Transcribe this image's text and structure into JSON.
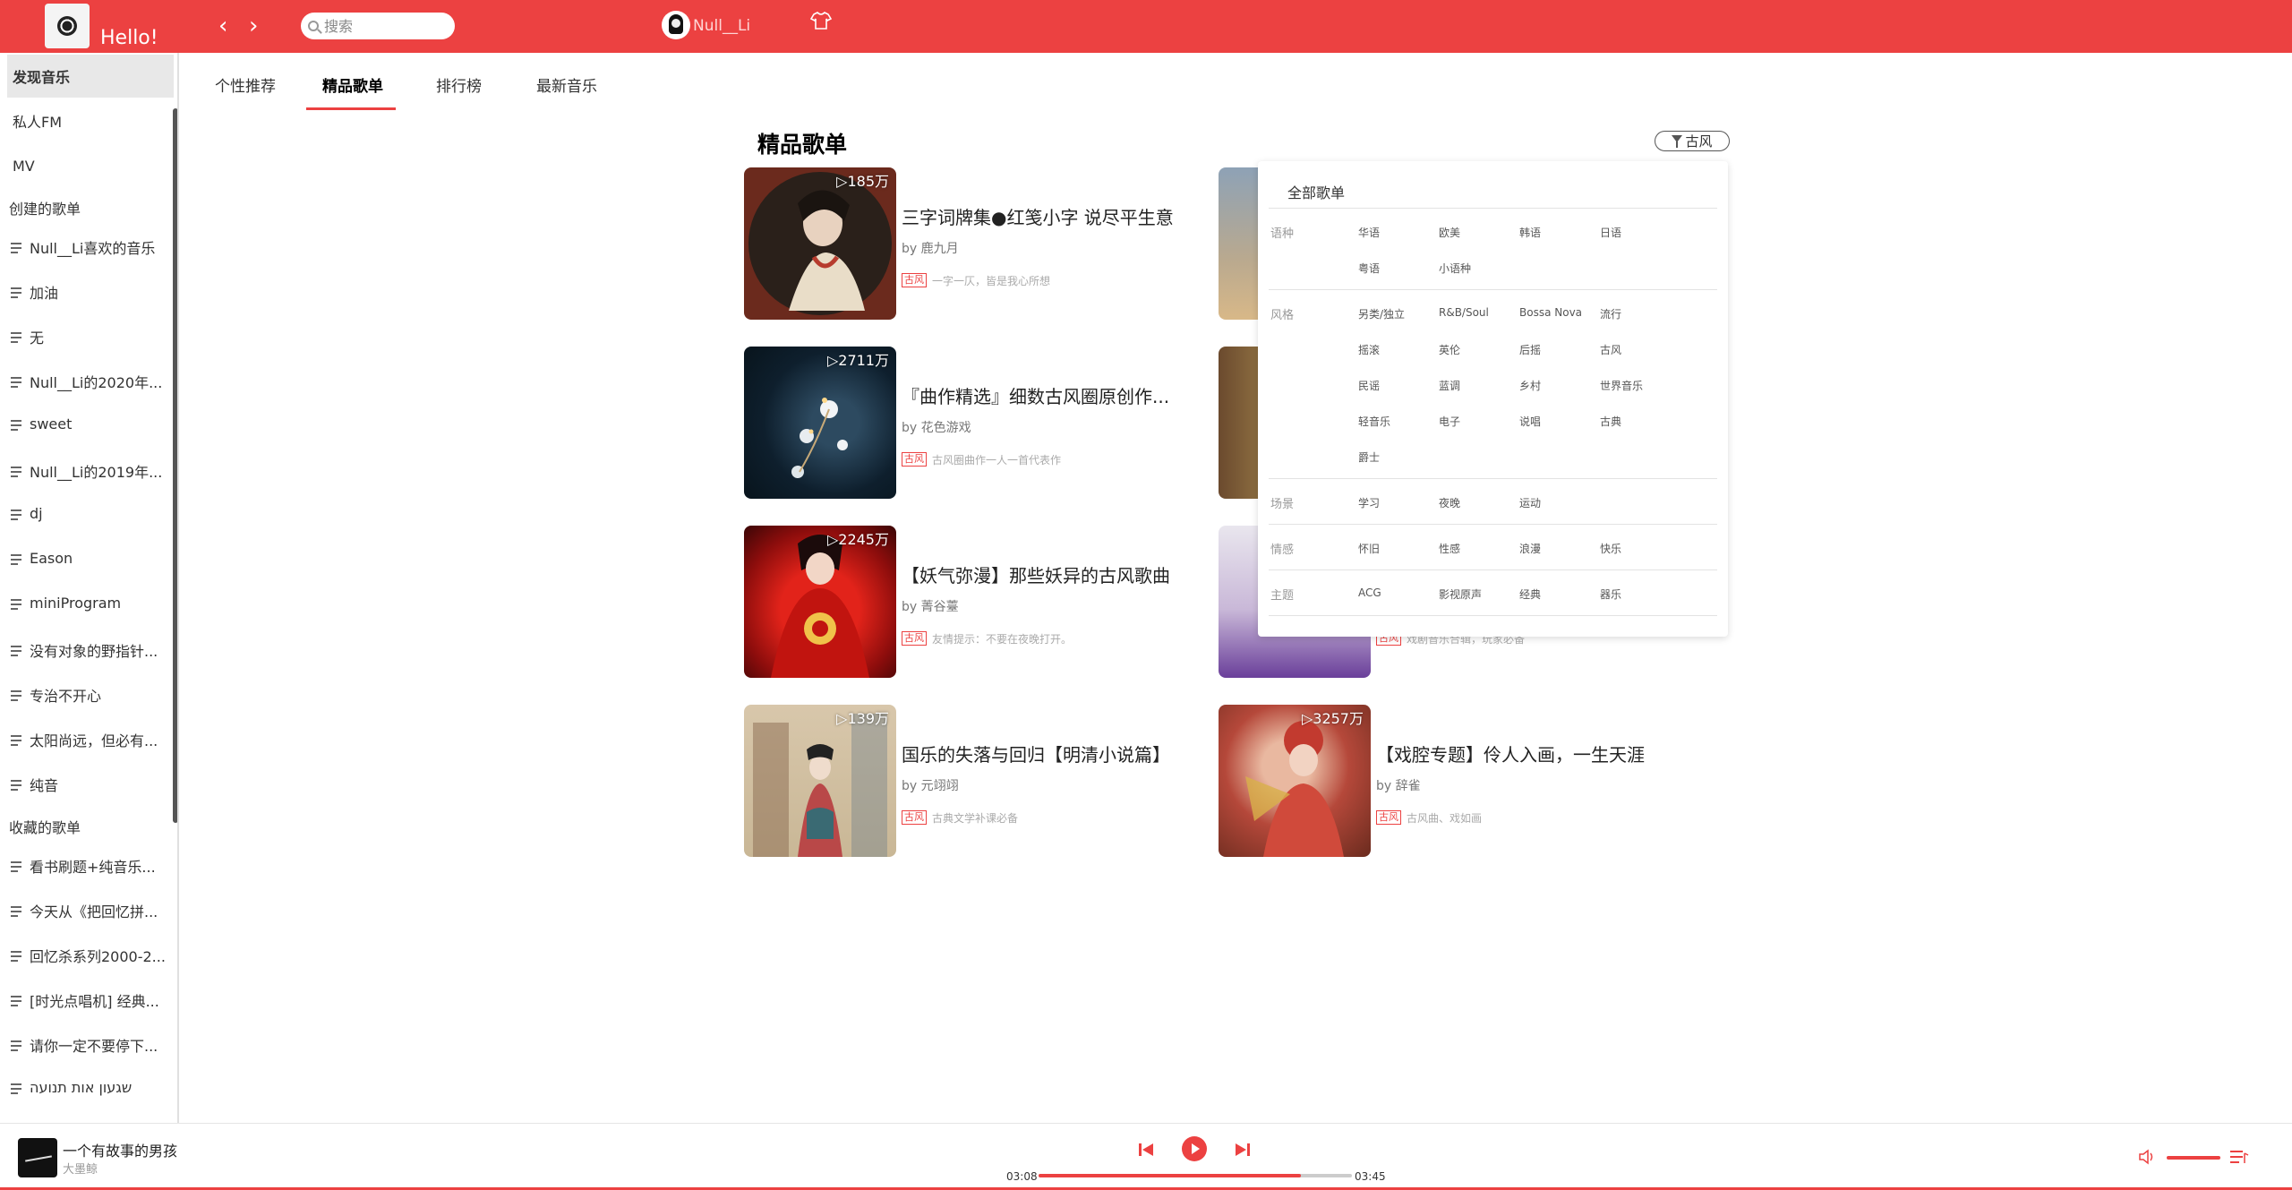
{
  "header": {
    "greeting": "Hello!",
    "search_placeholder": "搜索",
    "user_name": "Null__Li"
  },
  "sidebar": {
    "nav": [
      {
        "label": "发现音乐",
        "active": true
      },
      {
        "label": "私人FM"
      },
      {
        "label": "MV"
      }
    ],
    "created_title": "创建的歌单",
    "created": [
      "Null__Li喜欢的音乐",
      "加油",
      "无",
      "Null__Li的2020年...",
      "sweet",
      "Null__Li的2019年...",
      "dj",
      "Eason",
      "miniProgram",
      "没有对象的野指针...",
      "专治不开心",
      "太阳尚远，但必有...",
      "纯音"
    ],
    "collected_title": "收藏的歌单",
    "collected": [
      "看书刷题+纯音乐...",
      "今天从《把回忆拼...",
      "回忆杀系列2000-2...",
      "[时光点唱机] 经典...",
      "请你一定不要停下...",
      "שגעון אות תנועה"
    ]
  },
  "tabs": [
    "个性推荐",
    "精品歌单",
    "排行榜",
    "最新音乐"
  ],
  "main": {
    "title": "精品歌单",
    "filter_label": "古风",
    "playlists": [
      {
        "count": "185万",
        "name": "三字词牌集●红笺小字 说尽平生意",
        "by": "by 鹿九月",
        "tag": "古风",
        "desc": "一字一仄，皆是我心所想"
      },
      {
        "count": "2711万",
        "name": "『曲作精选』细数古风圈原创作...",
        "by": "by 花色游戏",
        "tag": "古风",
        "desc": "古风圈曲作一人一首代表作"
      },
      {
        "count": "2245万",
        "name": "【妖气弥漫】那些妖异的古风歌曲",
        "by": "by 菁谷薹",
        "tag": "古风",
        "desc": "友情提示：不要在夜晚打开。"
      },
      {
        "count": "139万",
        "name": "国乐的失落与回归【明清小说篇】",
        "by": "by 元翊翊",
        "tag": "古风",
        "desc": "古典文学补课必备"
      },
      {
        "count": "",
        "name": "",
        "by": "",
        "tag": "古风",
        "desc": "戏剧音乐合辑，玩家必备"
      },
      {
        "count": "3257万",
        "name": "【戏腔专题】伶人入画，一生天涯",
        "by": "by 辞雀",
        "tag": "古风",
        "desc": "古风曲、戏如画"
      }
    ]
  },
  "dropdown": {
    "all_label": "全部歌单",
    "groups": [
      {
        "name": "语种",
        "rows": [
          [
            "华语",
            "欧美",
            "韩语",
            "日语"
          ],
          [
            "粤语",
            "小语种"
          ]
        ]
      },
      {
        "name": "风格",
        "rows": [
          [
            "另类/独立",
            "R&B/Soul",
            "Bossa Nova",
            "流行"
          ],
          [
            "摇滚",
            "英伦",
            "后摇",
            "古风"
          ],
          [
            "民谣",
            "蓝调",
            "乡村",
            "世界音乐"
          ],
          [
            "轻音乐",
            "电子",
            "说唱",
            "古典"
          ],
          [
            "爵士"
          ]
        ]
      },
      {
        "name": "场景",
        "rows": [
          [
            "学习",
            "夜晚",
            "运动"
          ]
        ]
      },
      {
        "name": "情感",
        "rows": [
          [
            "怀旧",
            "性感",
            "浪漫",
            "快乐"
          ]
        ]
      },
      {
        "name": "主题",
        "rows": [
          [
            "ACG",
            "影视原声",
            "经典",
            "器乐"
          ]
        ]
      }
    ]
  },
  "player": {
    "title": "一个有故事的男孩",
    "artist": "大墨鲸",
    "current_time": "03:08",
    "total_time": "03:45",
    "progress": 0.836,
    "volume": 1.0,
    "accent": "#ec4141"
  },
  "colors": {
    "accent": "#ec4141"
  }
}
